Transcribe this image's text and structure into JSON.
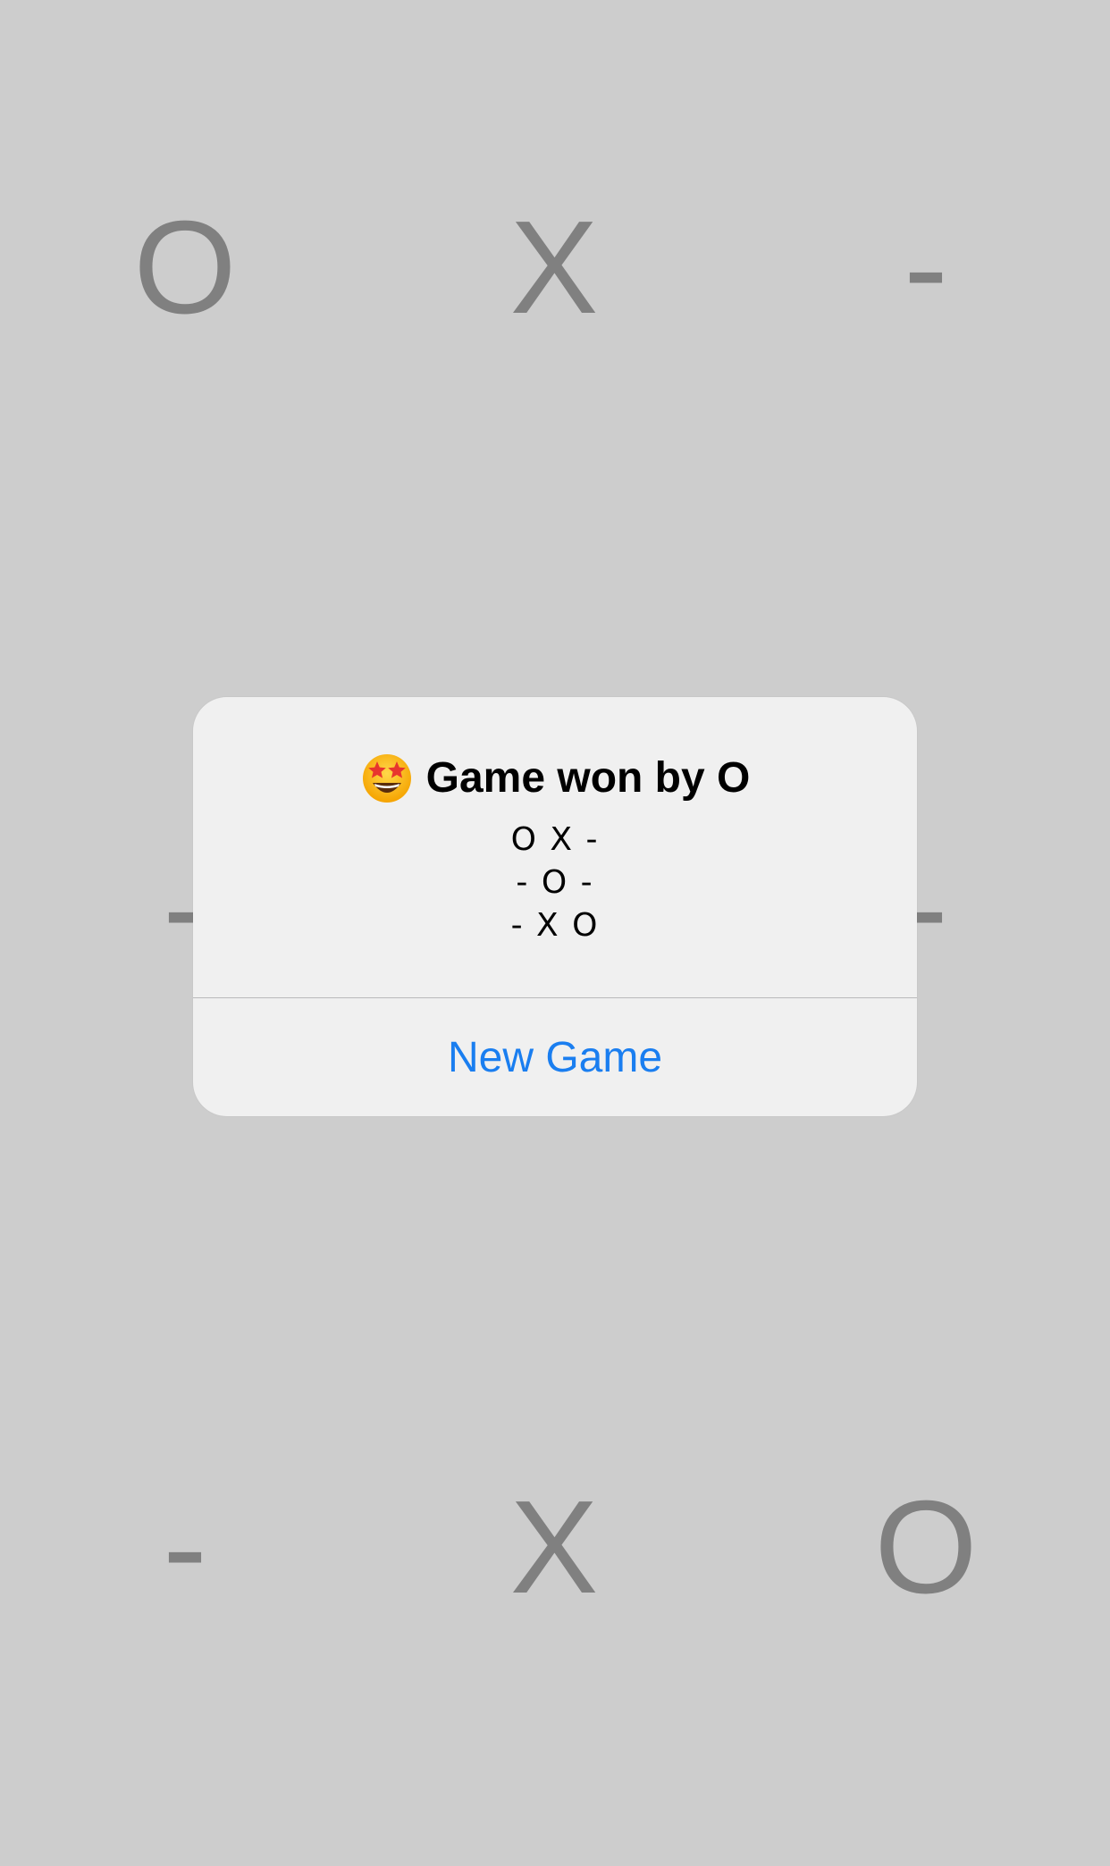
{
  "board": {
    "cells": [
      [
        "O",
        "X",
        "-"
      ],
      [
        "-",
        "O",
        "-"
      ],
      [
        "-",
        "X",
        "O"
      ]
    ]
  },
  "alert": {
    "icon": "star-struck-emoji-icon",
    "title": "Game won by O",
    "board_lines": [
      "O X -",
      "- O -",
      "- X O"
    ],
    "button_label": "New Game"
  },
  "colors": {
    "background": "#cdcdcd",
    "cell_text": "#808080",
    "alert_background": "#f0f0f0",
    "button_text": "#1a7ef0"
  }
}
